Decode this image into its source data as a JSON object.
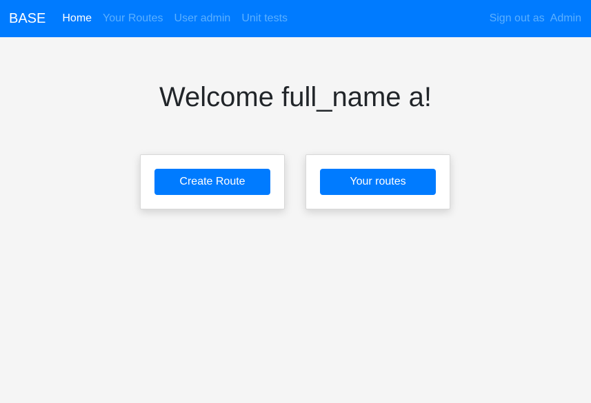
{
  "nav": {
    "brand": "BASE",
    "links": [
      "Home",
      "Your Routes",
      "User admin",
      "Unit tests"
    ],
    "sign_out_label": "Sign out as",
    "user": "Admin"
  },
  "main": {
    "welcome": "Welcome full_name a!",
    "create_route": "Create Route",
    "your_routes": "Your routes"
  },
  "colors": {
    "accent": "#007bff",
    "background": "#f5f5f5"
  }
}
